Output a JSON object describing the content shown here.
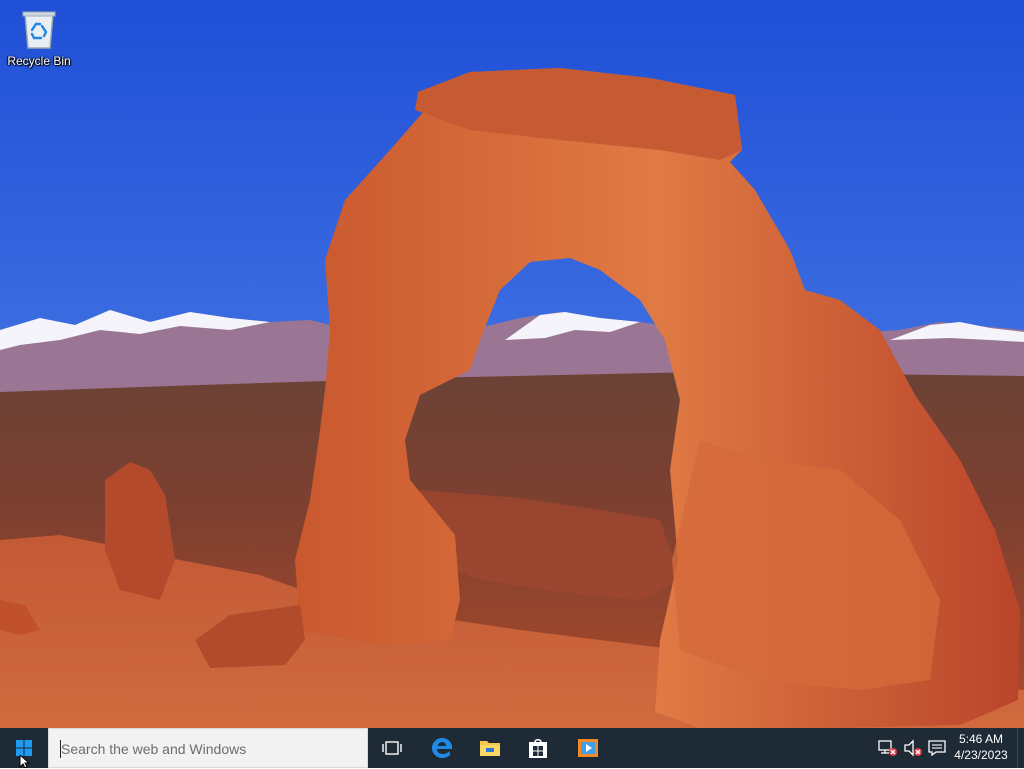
{
  "desktop": {
    "icons": [
      {
        "label": "Recycle Bin",
        "icon": "recycle-bin-icon"
      }
    ]
  },
  "taskbar": {
    "search": {
      "placeholder": "Search the web and Windows",
      "value": ""
    },
    "apps": [
      {
        "name": "Task View",
        "icon": "task-view-icon"
      },
      {
        "name": "Microsoft Edge",
        "icon": "edge-icon"
      },
      {
        "name": "File Explorer",
        "icon": "file-explorer-icon"
      },
      {
        "name": "Store",
        "icon": "store-icon"
      },
      {
        "name": "Media Player",
        "icon": "media-player-icon"
      }
    ],
    "tray": {
      "network": "network-disconnected-icon",
      "volume": "volume-muted-icon",
      "notifications": "action-center-icon"
    },
    "clock": {
      "time": "5:46 AM",
      "date": "4/23/2023"
    }
  },
  "colors": {
    "taskbar": "#1e2a36",
    "accent": "#0078d7",
    "sky": "#2f62d8"
  }
}
